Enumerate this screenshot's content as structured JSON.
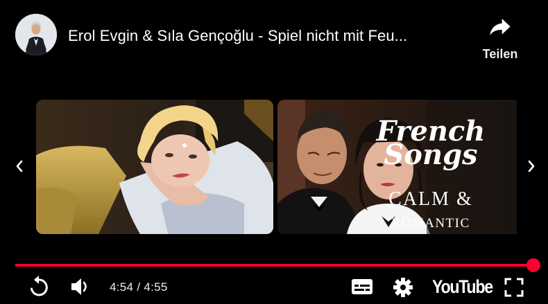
{
  "header": {
    "title": "Erol Evgin & Sıla Gençoğlu - Spiel nicht mit Feu...",
    "share_label": "Teilen"
  },
  "carousel": {
    "items": [
      {
        "name": "thumbnail-woman-portrait"
      },
      {
        "name": "thumbnail-french-songs",
        "line1": "French",
        "line2": "Songs",
        "line3": "CALM &",
        "line4": "ROMANTIC"
      }
    ]
  },
  "player": {
    "current_time": "4:54",
    "separator": "/",
    "duration": "4:55",
    "progress": 0.996,
    "accent_color": "#ff0033",
    "brand_label": "YouTube"
  },
  "icons": {
    "share": "share-arrow-icon",
    "prev": "chevron-left-icon",
    "next": "chevron-right-icon",
    "replay": "replay-icon",
    "volume": "volume-icon",
    "captions": "subtitles-icon",
    "settings": "gear-icon",
    "fullscreen": "fullscreen-icon"
  }
}
